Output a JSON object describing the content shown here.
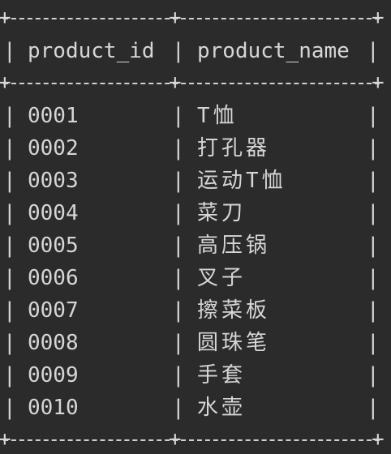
{
  "table": {
    "columns": [
      "product_id",
      "product_name"
    ],
    "rows": [
      {
        "product_id": "0001",
        "product_name": "T恤"
      },
      {
        "product_id": "0002",
        "product_name": "打孔器"
      },
      {
        "product_id": "0003",
        "product_name": "运动T恤"
      },
      {
        "product_id": "0004",
        "product_name": "菜刀"
      },
      {
        "product_id": "0005",
        "product_name": "高压锅"
      },
      {
        "product_id": "0006",
        "product_name": "叉子"
      },
      {
        "product_id": "0007",
        "product_name": "擦菜板"
      },
      {
        "product_id": "0008",
        "product_name": "圆珠笔"
      },
      {
        "product_id": "0009",
        "product_name": "手套"
      },
      {
        "product_id": "0010",
        "product_name": "水壶"
      }
    ]
  },
  "colors": {
    "background": "#2b2b2b",
    "text": "#d6d6d6"
  }
}
